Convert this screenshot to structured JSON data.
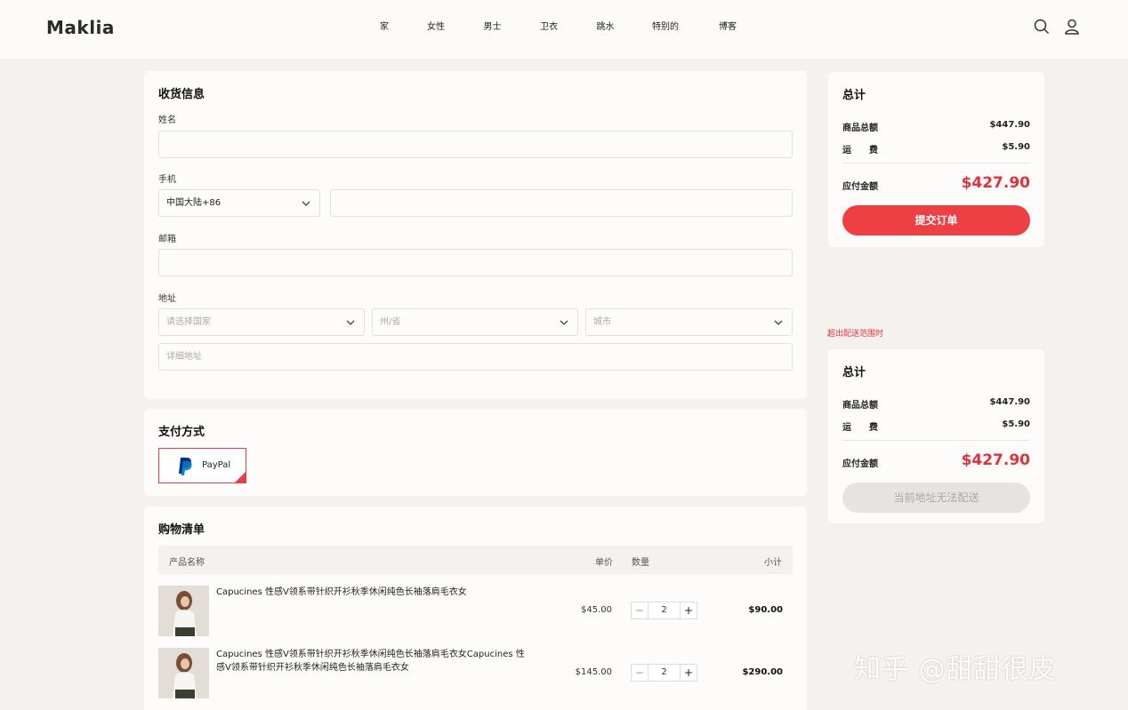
{
  "header": {
    "logo": "Maklia",
    "nav": [
      "家",
      "女性",
      "男士",
      "卫衣",
      "跳水",
      "特别的",
      "博客"
    ]
  },
  "shipping": {
    "title": "收货信息",
    "name_label": "姓名",
    "phone_label": "手机",
    "phone_region": "中国大陆+86",
    "email_label": "邮箱",
    "address_label": "地址",
    "country_placeholder": "请选择国家",
    "state_placeholder": "州/省",
    "city_placeholder": "城市",
    "detail_placeholder": "详细地址"
  },
  "payment": {
    "title": "支付方式",
    "method": "PayPal"
  },
  "cart": {
    "title": "购物清单",
    "columns": {
      "product": "产品名称",
      "unit_price": "单价",
      "qty": "数量",
      "subtotal": "小计"
    },
    "items": [
      {
        "name": "Capucines 性感V领系带针织开衫秋季休闲纯色长袖落肩毛衣女",
        "price": "$45.00",
        "qty": "2",
        "subtotal": "$90.00"
      },
      {
        "name": "Capucines 性感V领系带针织开衫秋季休闲纯色长袖落肩毛衣女Capucines 性感V领系带针织开衫秋季休闲纯色长袖落肩毛衣女",
        "price": "$145.00",
        "qty": "2",
        "subtotal": "$290.00"
      }
    ]
  },
  "summary": {
    "title": "总计",
    "goods_label": "商品总额",
    "goods_value": "$447.90",
    "shipping_label": "运　　费",
    "shipping_value": "$5.90",
    "payable_label": "应付金额",
    "payable_value": "$427.90",
    "submit": "提交订单"
  },
  "summary_out": {
    "warning": "超出配送范围时",
    "title": "总计",
    "goods_label": "商品总额",
    "goods_value": "$447.90",
    "shipping_label": "运　　费",
    "shipping_value": "$5.90",
    "payable_label": "应付金额",
    "payable_value": "$427.90",
    "disabled_button": "当前地址无法配送"
  },
  "watermark": "知乎 @甜甜很皮",
  "colors": {
    "accent": "#ee3f43",
    "price_red": "#e0323c",
    "background": "#f4f1ee",
    "card": "#fdfcfa"
  }
}
